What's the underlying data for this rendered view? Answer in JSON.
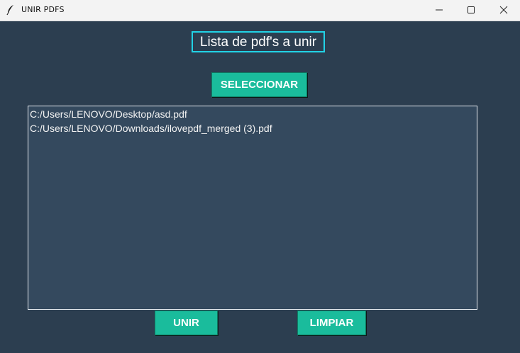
{
  "window": {
    "title": "UNIR PDFS",
    "icon": "feather-icon",
    "controls": [
      "minimize-icon",
      "maximize-icon",
      "close-icon"
    ]
  },
  "main": {
    "heading": "Lista de pdf's a unir",
    "select_label": "SELECCIONAR",
    "files": [
      "C:/Users/LENOVO/Desktop/asd.pdf",
      "C:/Users/LENOVO/Downloads/ilovepdf_merged (3).pdf"
    ],
    "join_label": "UNIR",
    "clear_label": "LIMPIAR"
  },
  "colors": {
    "background": "#2c3e50",
    "button": "#1abc9c",
    "heading_border": "#22d3e6",
    "listbox": "#34495e"
  }
}
